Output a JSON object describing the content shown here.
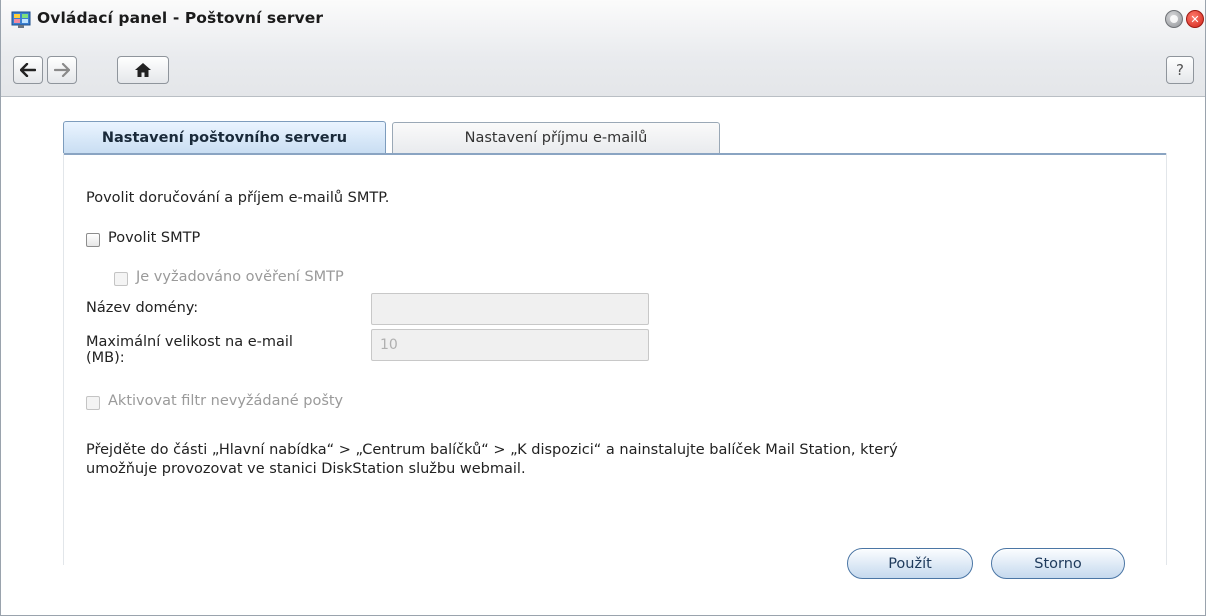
{
  "window": {
    "title": "Ovládací panel - Poštovní server",
    "help_label": "?"
  },
  "tabs": [
    {
      "label": "Nastavení poštovního serveru",
      "active": true
    },
    {
      "label": "Nastavení příjmu e-mailů",
      "active": false
    }
  ],
  "form": {
    "intro": "Povolit doručování a příjem e-mailů SMTP.",
    "enable_smtp": {
      "label": "Povolit SMTP",
      "checked": false,
      "enabled": true
    },
    "smtp_auth": {
      "label": "Je vyžadováno ověření SMTP",
      "checked": false,
      "enabled": false
    },
    "domain_name": {
      "label": "Název domény:",
      "value": ""
    },
    "max_size": {
      "label_line1": "Maximální velikost na e-mail",
      "label_line2": "(MB):",
      "value": "10"
    },
    "spam_filter": {
      "label": "Aktivovat filtr nevyžádané pošty",
      "checked": false,
      "enabled": false
    },
    "note_line1": "Přejděte do části „Hlavní nabídka“ > „Centrum balíčků“ > „K dispozici“ a nainstalujte balíček Mail Station, který",
    "note_line2": "umožňuje provozovat ve stanici DiskStation službu webmail."
  },
  "buttons": {
    "apply": "Použít",
    "cancel": "Storno"
  },
  "colors": {
    "accent": "#8aa4c2",
    "close": "#d0231a"
  }
}
